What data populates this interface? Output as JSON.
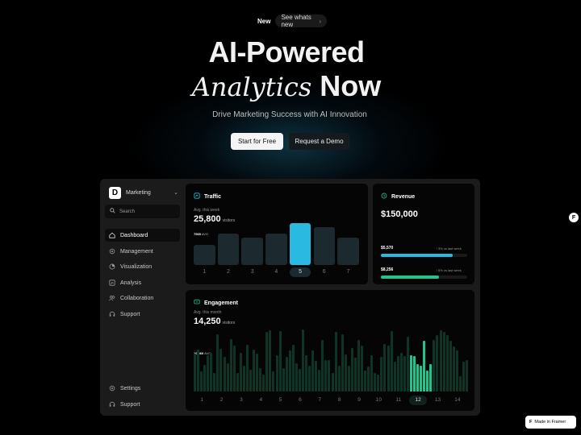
{
  "announcement": {
    "badge": "New",
    "link": "See whats new"
  },
  "hero": {
    "title_line1": "AI-Powered",
    "title_italic": "Analytics",
    "title_bold": "Now",
    "subtitle": "Drive Marketing Success with AI Innovation",
    "primary_cta": "Start for Free",
    "secondary_cta": "Request a Demo"
  },
  "sidebar": {
    "workspace_initial": "D",
    "workspace_name": "Marketing",
    "search_placeholder": "Search",
    "items": [
      {
        "label": "Dashboard",
        "icon": "home-icon",
        "active": true
      },
      {
        "label": "Management",
        "icon": "settings-icon",
        "active": false
      },
      {
        "label": "Visualization",
        "icon": "pie-icon",
        "active": false
      },
      {
        "label": "Analysis",
        "icon": "chart-icon",
        "active": false
      },
      {
        "label": "Collaboration",
        "icon": "users-icon",
        "active": false
      },
      {
        "label": "Support",
        "icon": "headset-icon",
        "active": false
      }
    ],
    "footer_items": [
      {
        "label": "Settings",
        "icon": "gear-icon"
      },
      {
        "label": "Support",
        "icon": "headset-icon"
      }
    ]
  },
  "traffic": {
    "title": "Traffic",
    "caption": "Avg. this week",
    "value": "25,800",
    "unit": "visitors",
    "avg_value": "7565",
    "avg_suffix": "AVG",
    "bars": [
      {
        "label": "1",
        "level": 0.38,
        "selected": false
      },
      {
        "label": "2",
        "level": 0.6,
        "selected": false
      },
      {
        "label": "3",
        "level": 0.53,
        "selected": false
      },
      {
        "label": "4",
        "level": 0.6,
        "selected": false
      },
      {
        "label": "5",
        "level": 0.8,
        "selected": true
      },
      {
        "label": "6",
        "level": 0.73,
        "selected": false
      },
      {
        "label": "7",
        "level": 0.53,
        "selected": false
      }
    ]
  },
  "revenue": {
    "title": "Revenue",
    "amount": "$150,000",
    "rows": [
      {
        "value": "$5,570",
        "change": "3%",
        "suffix": "vs last week",
        "fill": 0.83,
        "color": "#2ab9e0"
      },
      {
        "value": "$8,256",
        "change": "5%",
        "suffix": "vs last week",
        "fill": 0.67,
        "color": "#25c38a"
      }
    ]
  },
  "engagement": {
    "title": "Engagement",
    "caption": "Avg. this month",
    "value": "14,250",
    "unit": "visitors",
    "avg_value": "10 560",
    "avg_suffix": "AVG",
    "day_labels": [
      "1",
      "2",
      "3",
      "4",
      "5",
      "6",
      "7",
      "8",
      "9",
      "10",
      "11",
      "12",
      "13",
      "14"
    ],
    "selected_day": "12"
  },
  "footer": {
    "badge": "Made in Framer"
  },
  "colors": {
    "accent_blue": "#2ab9e0",
    "accent_green": "#25c38a",
    "background": "#000000",
    "panel": "#1b1b1b",
    "card": "#050505"
  }
}
